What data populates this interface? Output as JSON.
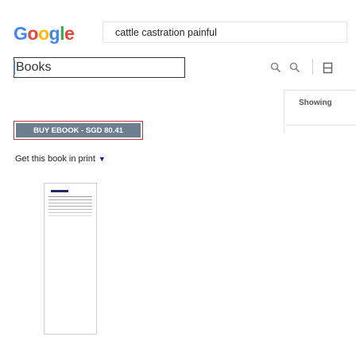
{
  "header": {
    "logo": [
      "G",
      "o",
      "o",
      "g",
      "l",
      "e"
    ],
    "logo_colors": [
      "#4285f4",
      "#ea4335",
      "#fbbc05",
      "#4285f4",
      "#34a853",
      "#ea4335"
    ],
    "search_query": "cattle castration painful"
  },
  "toolbar": {
    "books_label": "Books",
    "icons": [
      "search-icon",
      "search-icon",
      "bookmark-icon"
    ]
  },
  "side_panel": {
    "showing_label": "Showing"
  },
  "book": {
    "buy_label": "BUY EBOOK - SGD 80.41",
    "get_print_label": "Get this book in print",
    "get_print_caret": "▼"
  },
  "colors": {
    "buy_button": "#6b7f8f",
    "buy_border": "#c53333",
    "link": "#1a0dab"
  }
}
